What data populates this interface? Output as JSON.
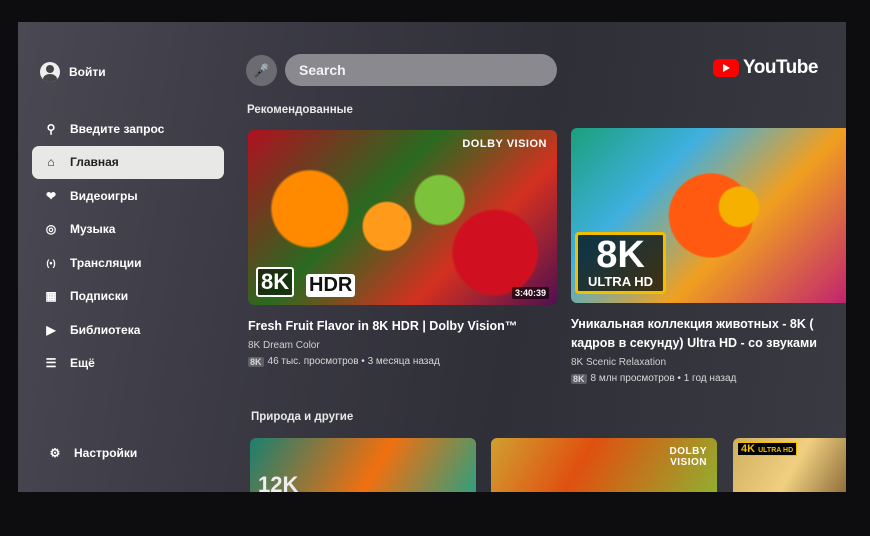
{
  "sidebar": {
    "signin_label": "Войти",
    "items": [
      {
        "label": "Введите запрос",
        "icon": "search-icon"
      },
      {
        "label": "Главная",
        "icon": "home-icon",
        "active": true
      },
      {
        "label": "Видеоигры",
        "icon": "gamepad-icon"
      },
      {
        "label": "Музыка",
        "icon": "music-icon"
      },
      {
        "label": "Трансляции",
        "icon": "live-icon"
      },
      {
        "label": "Подписки",
        "icon": "subscriptions-icon"
      },
      {
        "label": "Библиотека",
        "icon": "library-icon"
      },
      {
        "label": "Ещё",
        "icon": "menu-icon"
      }
    ],
    "settings_label": "Настройки"
  },
  "header": {
    "search_placeholder": "Search",
    "logo_text": "YouTube"
  },
  "shelves": [
    {
      "title": "Рекомендованные",
      "videos": [
        {
          "title": "Fresh Fruit Flavor in 8K HDR | Dolby Vision™",
          "channel": "8K Dream Color",
          "quality": "8K",
          "meta": "46 тыс. просмотров • 3 месяца назад",
          "duration": "3:40:39",
          "badges": [
            "8K",
            "HDR",
            "DOLBY VISION"
          ]
        },
        {
          "title": "Уникальная коллекция животных - 8K (",
          "title2": "кадров в секунду) Ultra HD - со звуками",
          "channel": "8K Scenic Relaxation",
          "quality": "8K",
          "meta": "8 млн просмотров • 1 год назад",
          "badges": [
            "8K",
            "ULTRA HD"
          ]
        }
      ]
    },
    {
      "title": "Природа и другие",
      "videos": [
        {
          "badges": [
            "12K"
          ]
        },
        {
          "badges": [
            "DOLBY VISION"
          ]
        },
        {
          "badges": [
            "4K",
            "ULTRA HD"
          ]
        }
      ]
    }
  ],
  "colors": {
    "accent": "#ff0000",
    "badge": "#f0c000"
  }
}
